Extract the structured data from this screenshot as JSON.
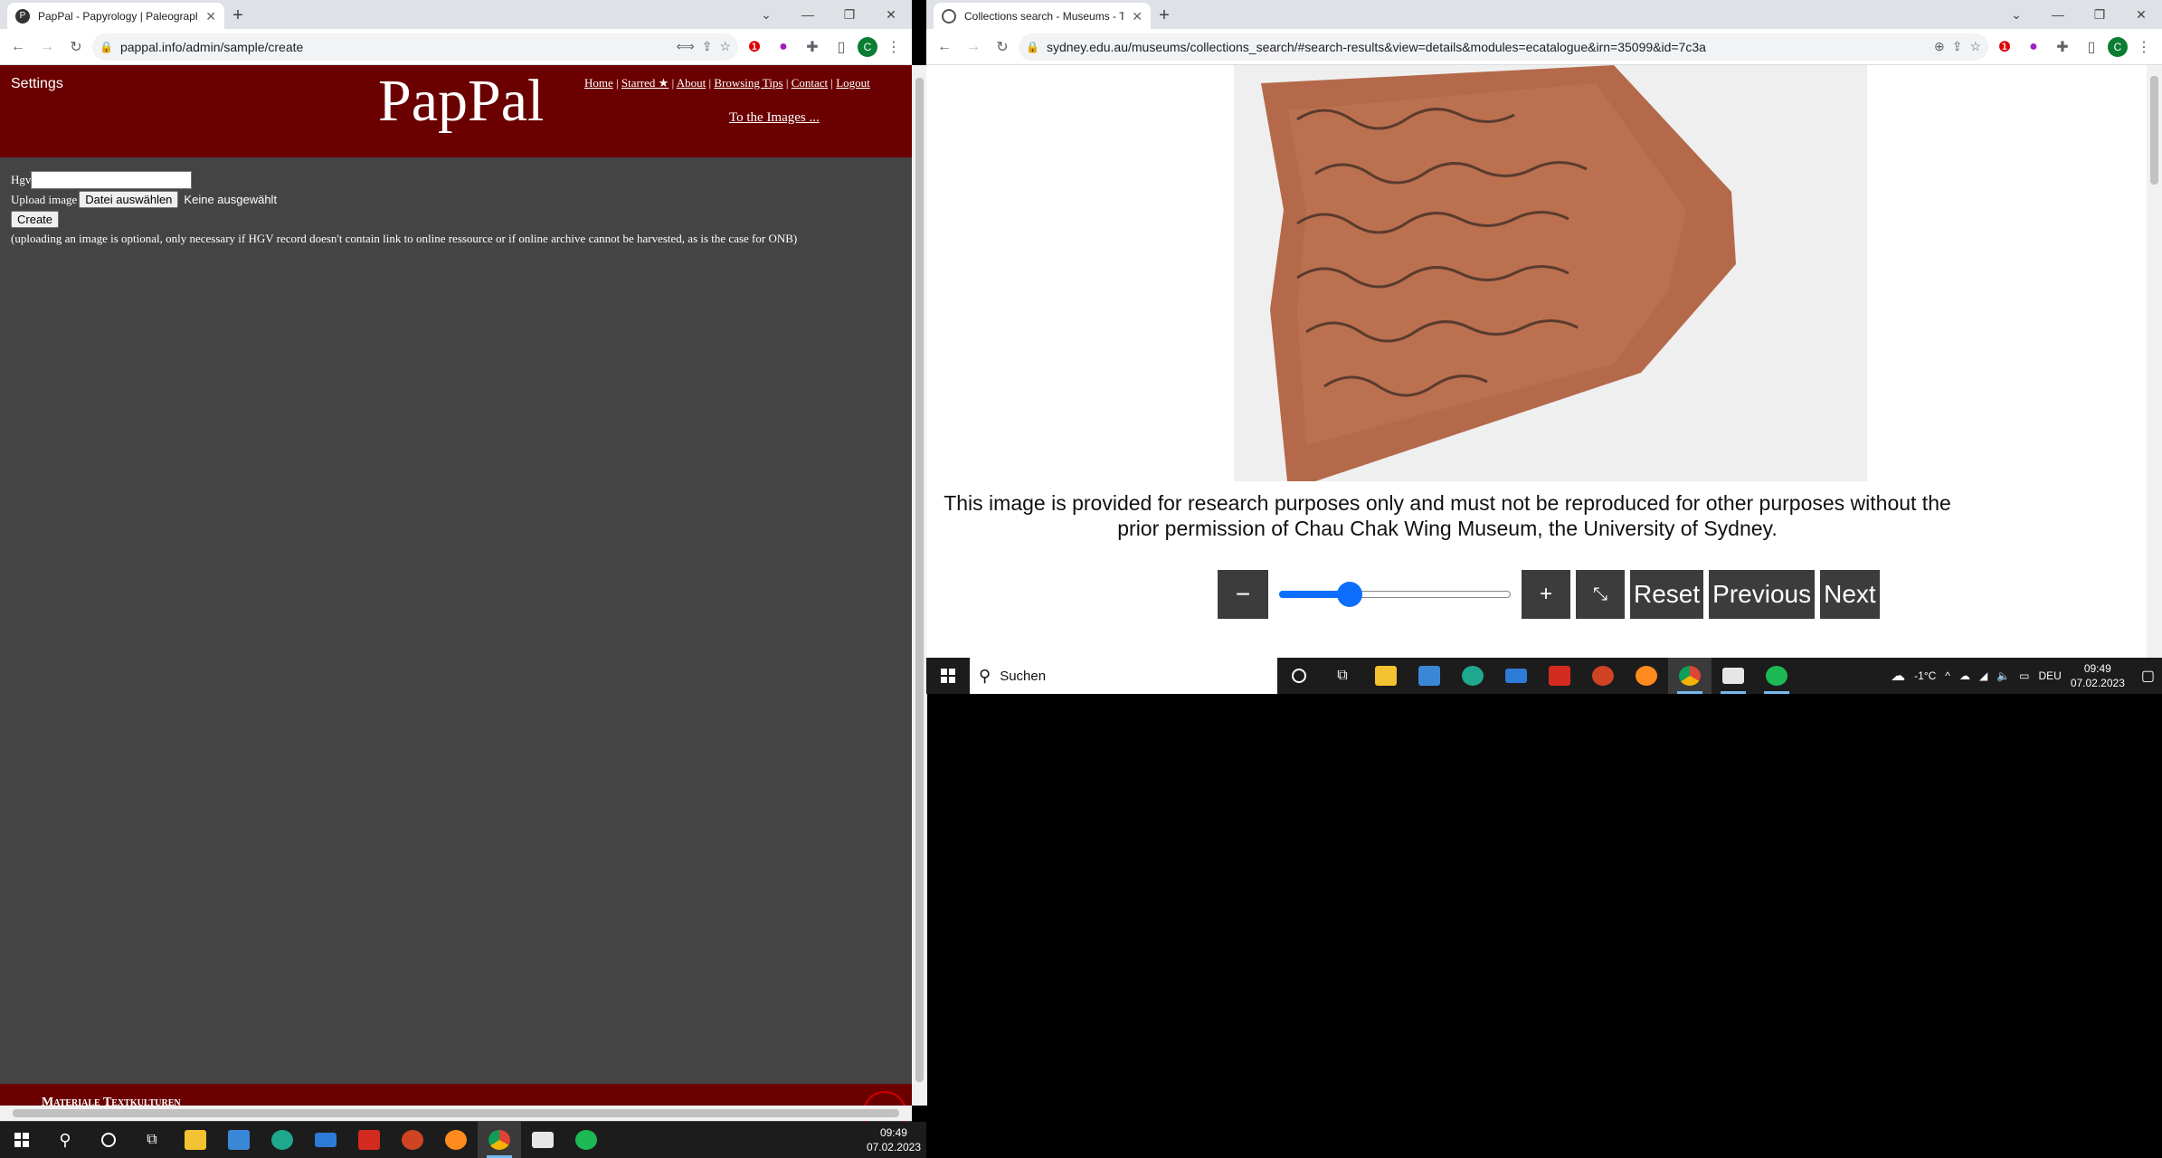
{
  "left_window": {
    "tab_title": "PapPal - Papyrology | Paleographi",
    "url": "pappal.info/admin/sample/create",
    "header": {
      "settings": "Settings",
      "logo": "PapPal",
      "nav": [
        "Home",
        "Starred ★",
        "About",
        "Browsing Tips",
        "Contact",
        "Logout"
      ],
      "to_images": "To the Images ..."
    },
    "form": {
      "hgv_label": "Hgv",
      "hgv_value": "",
      "upload_label": "Upload image",
      "file_button": "Datei auswählen",
      "file_status": "Keine ausgewählt",
      "create_button": "Create",
      "note": "(uploading an image is optional, only necessary if HGV record doesn't contain link to online ressource or if online archive cannot be harvested, as is the case for ONB)"
    },
    "footer_text": "Materiale Textkulturen",
    "taskbar": {
      "time": "09:49",
      "date": "07.02.2023"
    }
  },
  "right_window": {
    "tab_title": "Collections search - Museums - T",
    "url": "sydney.edu.au/museums/collections_search/#search-results&view=details&modules=ecatalogue&irn=35099&id=7c3a",
    "notice": "This image is provided for research purposes only and must not be reproduced for other purposes without the prior permission of Chau Chak Wing Museum, the University of Sydney.",
    "controls": {
      "minus": "−",
      "plus": "+",
      "reset": "Reset",
      "previous": "Previous",
      "next": "Next",
      "zoom_level": 0.28
    },
    "taskbar": {
      "search": "Suchen",
      "weather": "-1°C",
      "lang": "DEU",
      "time": "09:49",
      "date": "07.02.2023"
    }
  },
  "colors": {
    "pappal_header": "#6b0000",
    "pappal_body": "#444444",
    "taskbar": "#1c1c1c",
    "accent_blue": "#0d6efd",
    "button_gray": "#3c3c3c"
  },
  "icons": [
    "windows-start-icon",
    "search-icon",
    "cortana-icon",
    "task-view-icon",
    "file-explorer-icon",
    "store-icon",
    "edge-icon",
    "mail-icon",
    "acrobat-icon",
    "powerpoint-icon",
    "firefox-icon",
    "chrome-icon",
    "notes-icon",
    "spotify-icon"
  ]
}
